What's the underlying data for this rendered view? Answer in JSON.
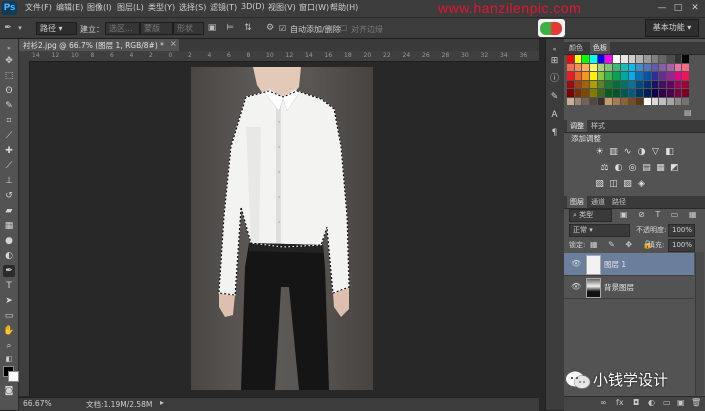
{
  "menubar": {
    "logo": "Ps",
    "items": [
      "文件(F)",
      "编辑(E)",
      "图像(I)",
      "图层(L)",
      "类型(Y)",
      "选择(S)",
      "滤镜(T)",
      "3D(D)",
      "视图(V)",
      "窗口(W)",
      "帮助(H)"
    ],
    "brand_watermark": "www.hanzilenpic.com",
    "window_controls": [
      "—",
      "□",
      "✕"
    ]
  },
  "options": {
    "tool_preset": "路径",
    "build_label": "建立：",
    "selection_btn": "选区...",
    "mask_btn": "蒙版",
    "shape_btn": "形状",
    "auto_add_delete": "自动添加/删除",
    "align_edges": "对齐边缘",
    "workspace": "基本功能"
  },
  "document": {
    "tab_title": "衬衫2.jpg @ 66.7% (图层 1, RGB/8#) *",
    "close": "×",
    "ruler_marks": [
      "14",
      "12",
      "10",
      "8",
      "6",
      "4",
      "2",
      "0",
      "2",
      "4",
      "6",
      "8",
      "10",
      "12",
      "14",
      "16",
      "18",
      "20",
      "22",
      "24",
      "26",
      "28",
      "30",
      "32",
      "34",
      "36"
    ],
    "zoom": "66.67%",
    "doc_size": "文档:1.19M/2.58M"
  },
  "swatches_panel": {
    "tabs": [
      "颜色",
      "色板"
    ],
    "active_tab": "色板",
    "colors": [
      "#ff0000",
      "#ffff00",
      "#00ff00",
      "#00ffff",
      "#0000ff",
      "#ff00ff",
      "#ffffff",
      "#e6e6e6",
      "#cccccc",
      "#b3b3b3",
      "#999999",
      "#808080",
      "#666666",
      "#4d4d4d",
      "#333333",
      "#000000",
      "#f26c4f",
      "#f68e56",
      "#fbaf5d",
      "#fff467",
      "#acd373",
      "#7cc576",
      "#3bb878",
      "#1abbb4",
      "#00bff3",
      "#438ccb",
      "#5574b9",
      "#605ca8",
      "#855fa8",
      "#a763a8",
      "#f06ea9",
      "#f26d7d",
      "#ed1c24",
      "#f26522",
      "#f7941d",
      "#fff200",
      "#8dc63f",
      "#39b54a",
      "#00a651",
      "#00a99d",
      "#00aeef",
      "#0072bc",
      "#0054a6",
      "#2e3192",
      "#662d91",
      "#92278f",
      "#ec008c",
      "#ed145b",
      "#9e0b0f",
      "#a0410d",
      "#a36209",
      "#aba000",
      "#598527",
      "#1a7b30",
      "#007236",
      "#00746b",
      "#0076a3",
      "#004b80",
      "#003471",
      "#1b1464",
      "#440e62",
      "#630460",
      "#9e005d",
      "#9e0039",
      "#790000",
      "#7b2e00",
      "#7d4900",
      "#827b00",
      "#406618",
      "#005e20",
      "#005826",
      "#005952",
      "#005b7f",
      "#003663",
      "#002157",
      "#0d004c",
      "#32004b",
      "#4b0049",
      "#7b0046",
      "#7a0026",
      "#c7b299",
      "#998675",
      "#736357",
      "#534741",
      "#37302d",
      "#c69c6d",
      "#a67c52",
      "#8c6239",
      "#754c24",
      "#603913",
      "#ffffff",
      "#d9d9d9",
      "#bfbfbf",
      "#a6a6a6",
      "#8c8c8c",
      "#737373"
    ]
  },
  "adjustments_panel": {
    "tabs": [
      "调整",
      "样式"
    ],
    "active_tab": "调整",
    "title": "添加调整",
    "icons": [
      "brightness-icon",
      "levels-icon",
      "curves-icon",
      "exposure-icon",
      "vibrance-icon",
      "hsl-icon",
      "color-balance-icon",
      "bw-icon",
      "photo-filter-icon",
      "channel-mixer-icon",
      "lookup-icon",
      "invert-icon",
      "posterize-icon",
      "threshold-icon",
      "gradient-map-icon",
      "selective-color-icon"
    ]
  },
  "layers_panel": {
    "tabs": [
      "图层",
      "通道",
      "路径"
    ],
    "active_tab": "图层",
    "filter_kind": "类型",
    "blend_mode": "正常",
    "opacity_label": "不透明度:",
    "opacity_value": "100%",
    "lock_label": "锁定:",
    "fill_label": "填充:",
    "fill_value": "100%",
    "layers": [
      {
        "name": "图层 1",
        "selected": true
      },
      {
        "name": "背景图层",
        "selected": false
      }
    ]
  },
  "watermark": {
    "account": "小钱学设计"
  }
}
